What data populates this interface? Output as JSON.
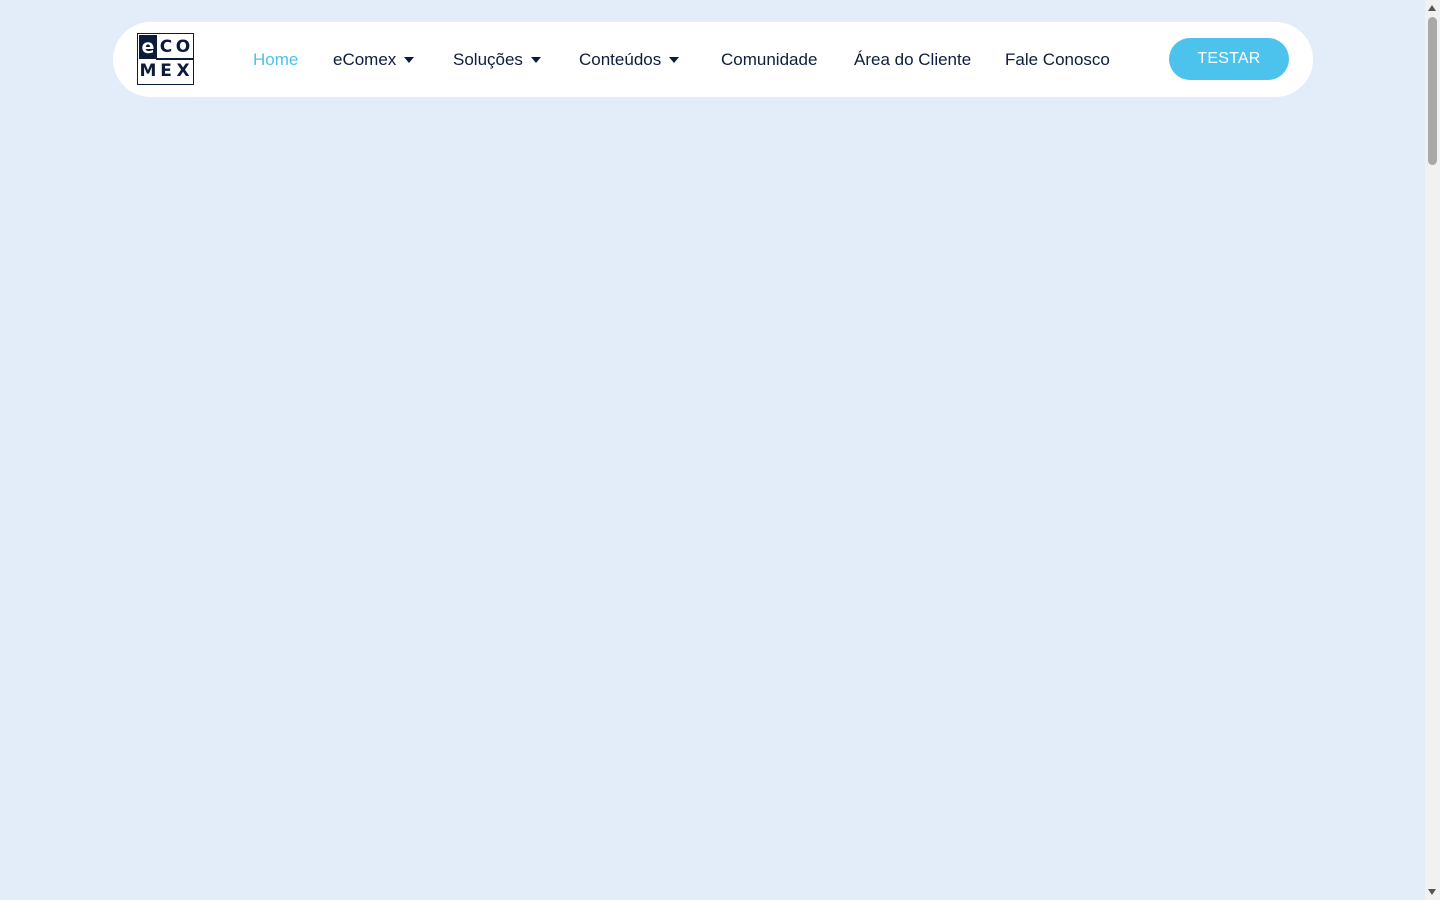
{
  "logo": {
    "cells": [
      "e",
      "C",
      "O",
      "M",
      "E",
      "X"
    ]
  },
  "nav": {
    "items": [
      {
        "label": "Home",
        "active": true,
        "dropdown": false
      },
      {
        "label": "eComex",
        "dropdown": true
      },
      {
        "label": "Soluções",
        "dropdown": true
      },
      {
        "label": "Conteúdos",
        "dropdown": true
      },
      {
        "label": "Comunidade",
        "dropdown": false
      },
      {
        "label": "Área do Cliente",
        "dropdown": false
      },
      {
        "label": "Fale Conosco",
        "dropdown": false
      }
    ],
    "cta_label": "TESTAR"
  },
  "colors": {
    "background": "#e3edfa",
    "accent": "#4cc3ec",
    "text": "#0e1d3d"
  },
  "icons": {
    "dropdown": "caret-down-icon"
  }
}
